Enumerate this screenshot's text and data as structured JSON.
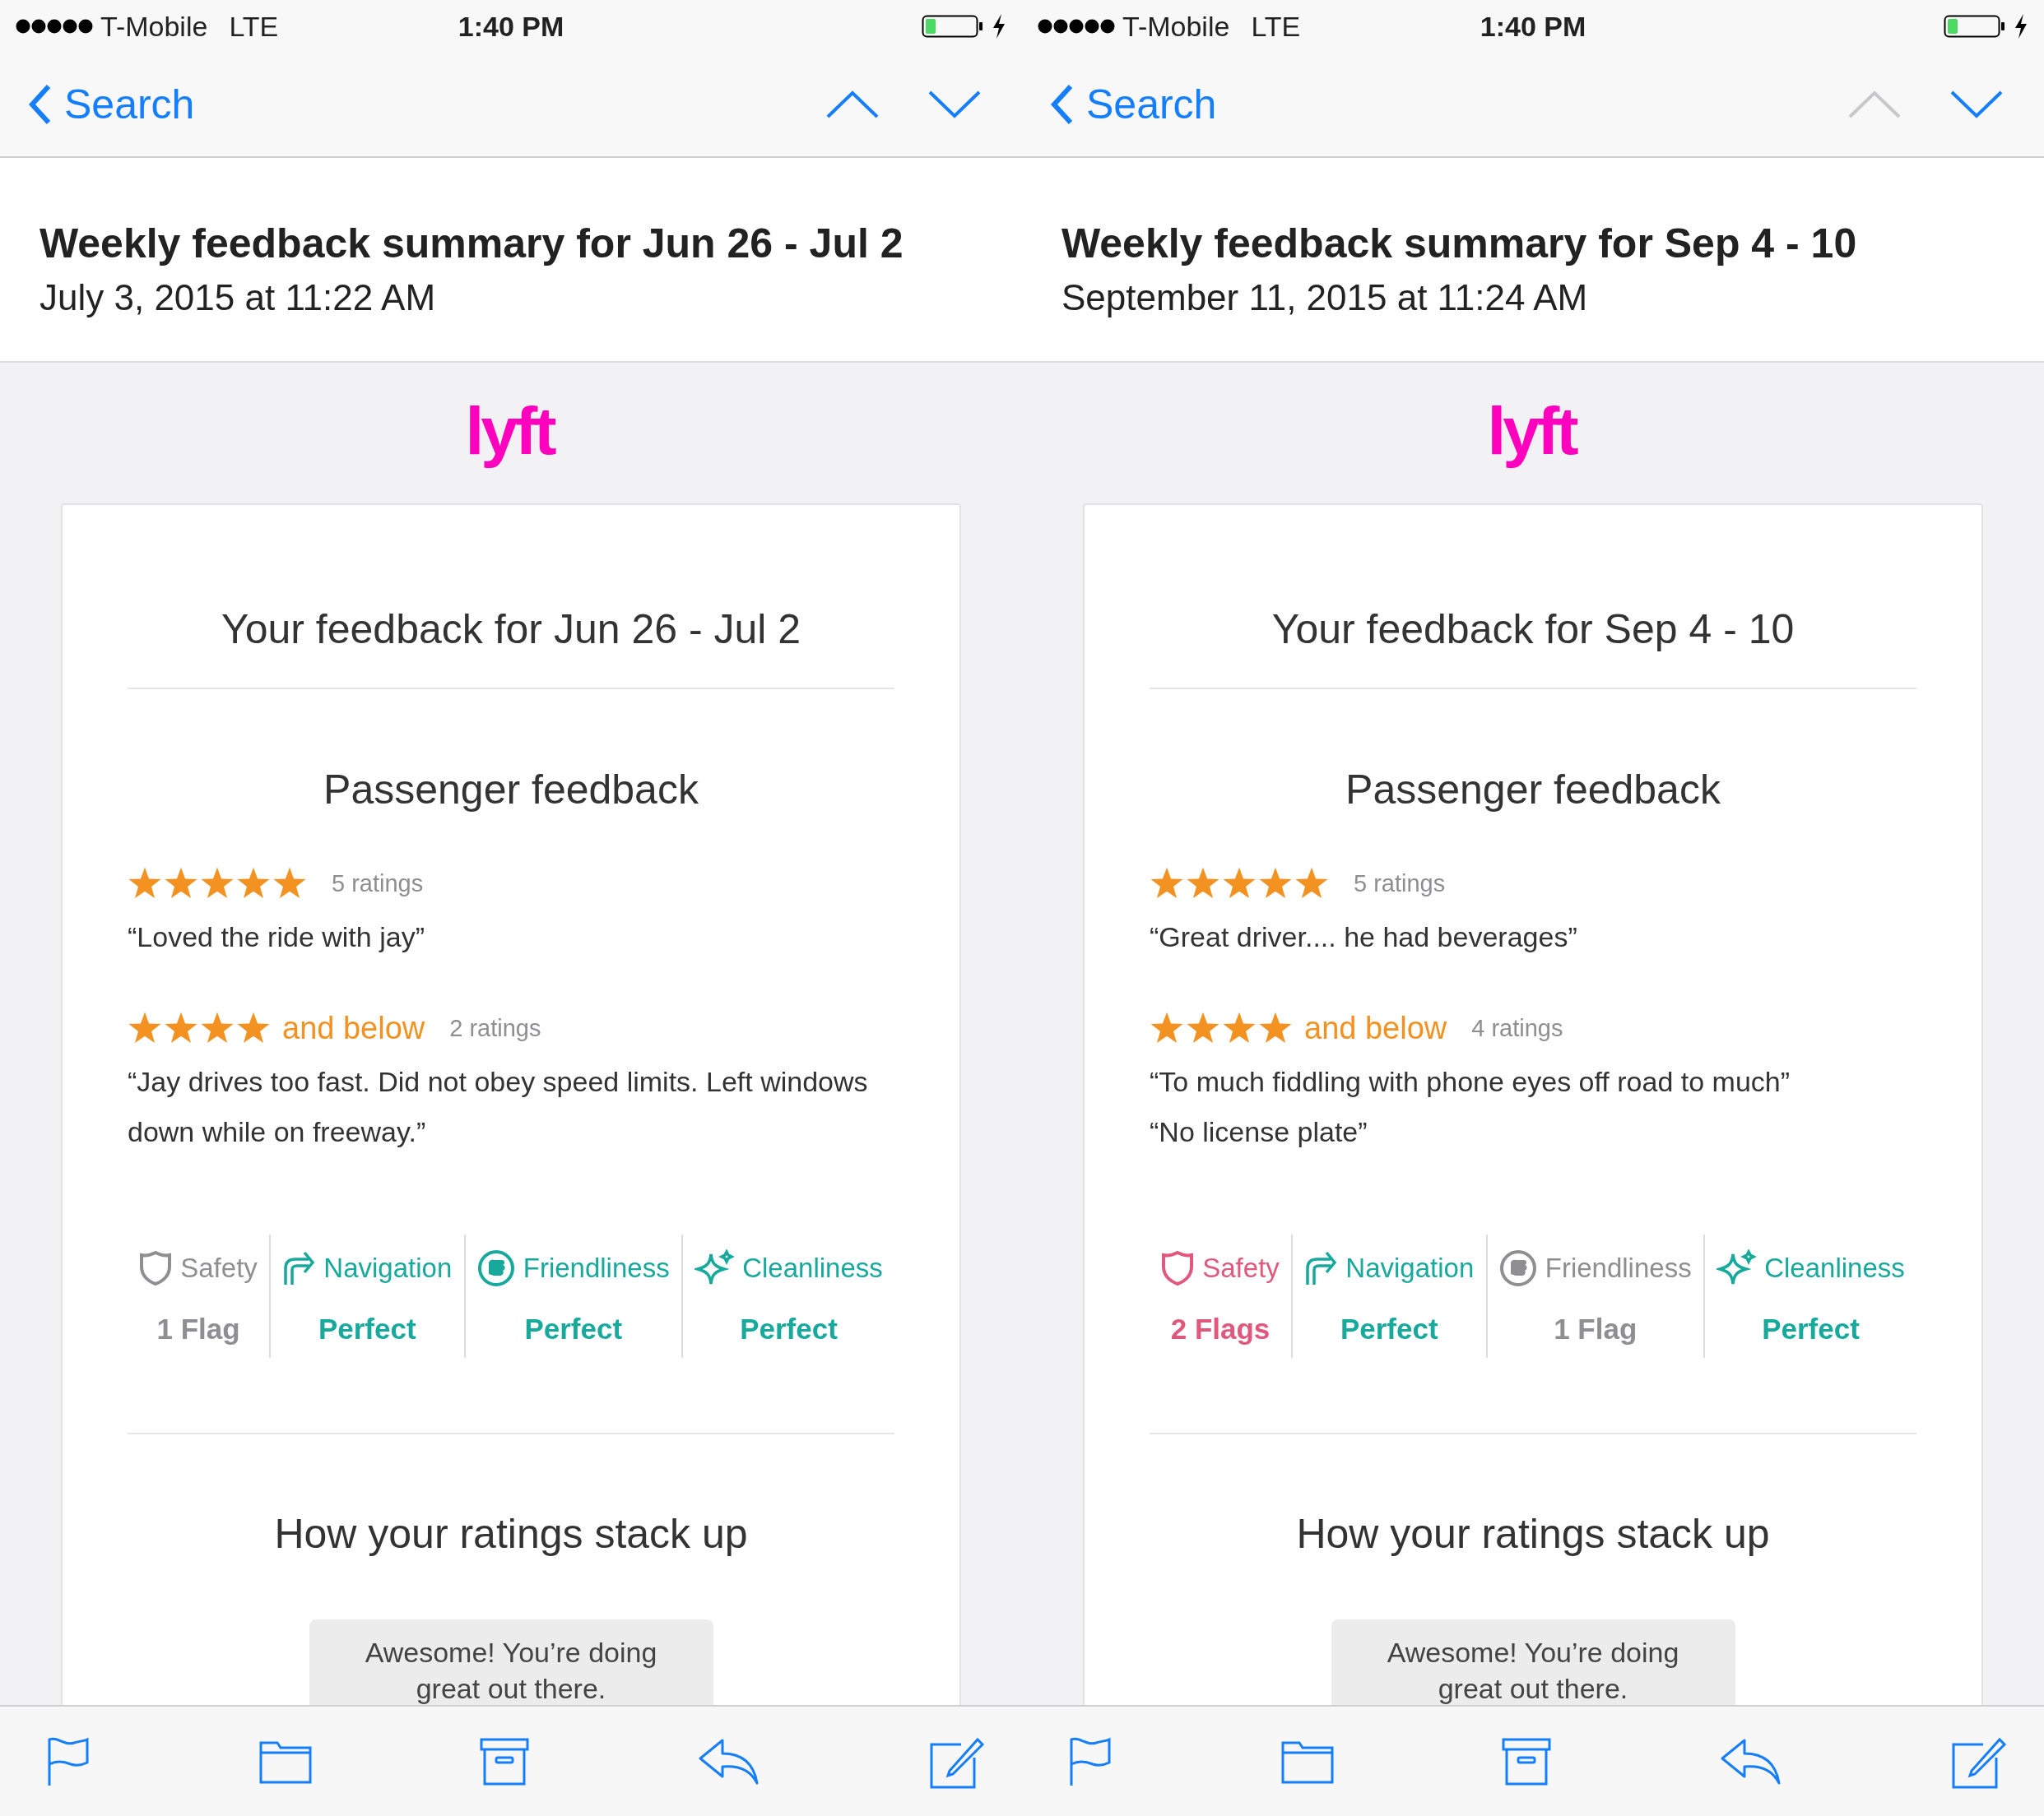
{
  "screens": [
    {
      "status_bar": {
        "carrier": "T-Mobile",
        "network": "LTE",
        "time": "1:40 PM"
      },
      "nav": {
        "back_label": "Search",
        "previous_disabled": false,
        "next_disabled": false
      },
      "email": {
        "subject": "Weekly feedback summary for Jun 26 - Jul 2",
        "date": "July 3, 2015 at 11:22 AM"
      },
      "logo": "lyft",
      "card": {
        "heading": "Your feedback for Jun 26 - Jul 2",
        "section_title": "Passenger feedback",
        "groups": [
          {
            "stars": 5,
            "count": "5 ratings",
            "comments": [
              "“Loved the ride with jay”"
            ]
          },
          {
            "stars": 4,
            "qualifier": "and below",
            "count": "2 ratings",
            "comments": [
              "“Jay drives too fast. Did not obey speed limits. Left windows down while on freeway.”"
            ]
          }
        ],
        "categories": [
          {
            "kind": "safety",
            "label": "Safety",
            "result": "1 Flag",
            "color": "#8e8e93"
          },
          {
            "kind": "navigation",
            "label": "Navigation",
            "result": "Perfect",
            "color": "#17a99c"
          },
          {
            "kind": "friendliness",
            "label": "Friendliness",
            "result": "Perfect",
            "color": "#17a99c"
          },
          {
            "kind": "cleanliness",
            "label": "Cleanliness",
            "result": "Perfect",
            "color": "#17a99c"
          }
        ],
        "stack_title": "How your ratings stack up",
        "bubble": "Awesome! You’re doing great out there."
      }
    },
    {
      "status_bar": {
        "carrier": "T-Mobile",
        "network": "LTE",
        "time": "1:40 PM"
      },
      "nav": {
        "back_label": "Search",
        "previous_disabled": true,
        "next_disabled": false
      },
      "email": {
        "subject": "Weekly feedback summary for Sep 4 - 10",
        "date": "September 11, 2015 at 11:24 AM"
      },
      "logo": "lyft",
      "card": {
        "heading": "Your feedback for Sep 4 - 10",
        "section_title": "Passenger feedback",
        "groups": [
          {
            "stars": 5,
            "count": "5 ratings",
            "comments": [
              "“Great driver.... he had beverages”"
            ]
          },
          {
            "stars": 4,
            "qualifier": "and below",
            "count": "4 ratings",
            "comments": [
              "“To much fiddling with phone eyes off road to much”",
              "“No license plate”"
            ]
          }
        ],
        "categories": [
          {
            "kind": "safety",
            "label": "Safety",
            "result": "2 Flags",
            "color": "#e0587c"
          },
          {
            "kind": "navigation",
            "label": "Navigation",
            "result": "Perfect",
            "color": "#17a99c"
          },
          {
            "kind": "friendliness",
            "label": "Friendliness",
            "result": "1 Flag",
            "color": "#8e8e93"
          },
          {
            "kind": "cleanliness",
            "label": "Cleanliness",
            "result": "Perfect",
            "color": "#17a99c"
          }
        ],
        "stack_title": "How your ratings stack up",
        "bubble": "Awesome! You’re doing great out there."
      }
    }
  ]
}
